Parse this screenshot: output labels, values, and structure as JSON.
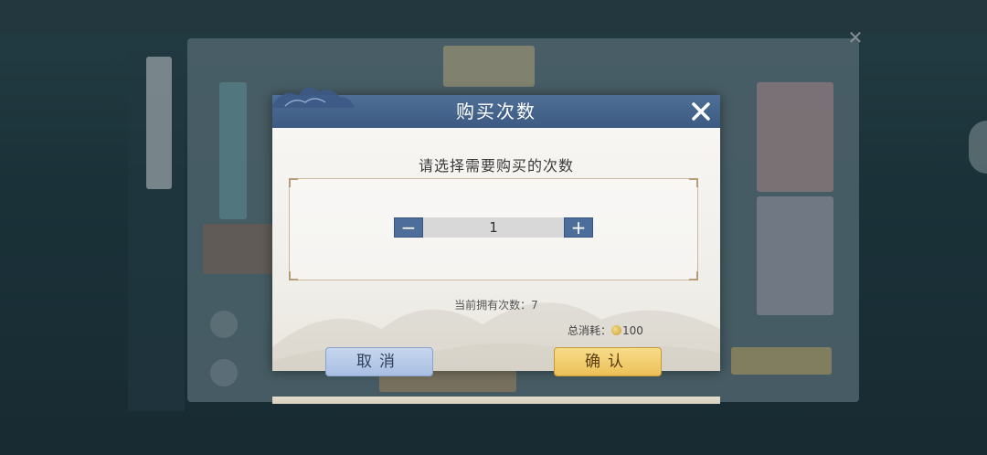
{
  "dialog": {
    "title": "购买次数",
    "prompt": "请选择需要购买的次数",
    "quantity": "1",
    "minus_label": "−",
    "plus_label": "+",
    "owned_text": "当前拥有次数：7",
    "cost_label": "总消耗：",
    "cost_value": "100",
    "cancel_label": "取消",
    "confirm_label": "确认"
  },
  "icons": {
    "close": "close-icon",
    "coin": "coin-icon"
  },
  "colors": {
    "header": "#3c5a82",
    "stepper_button": "#4d6d9a",
    "cancel_button": "#a9bfe3",
    "confirm_button": "#ecc058"
  }
}
